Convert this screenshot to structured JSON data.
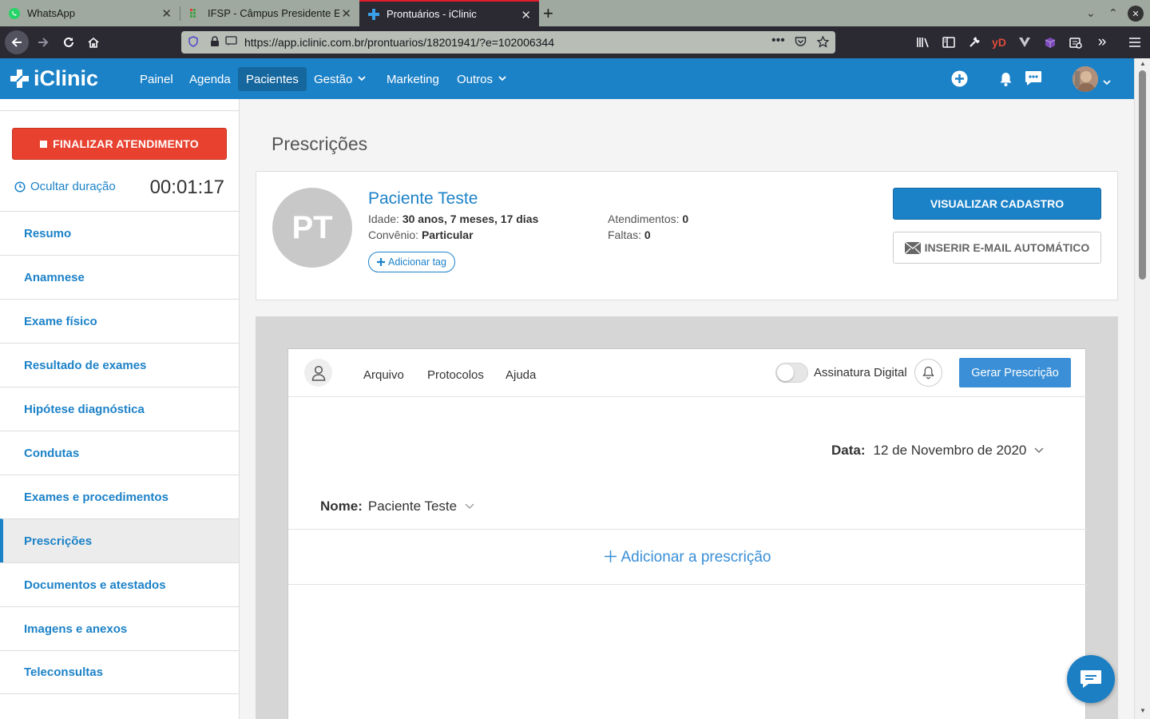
{
  "browser": {
    "tabs": [
      {
        "title": "WhatsApp",
        "icon": "whatsapp-icon"
      },
      {
        "title": "IFSP - Câmpus Presidente E",
        "icon": "ifsp-icon"
      },
      {
        "title": "Prontuários - iClinic",
        "icon": "iclinic-icon",
        "active": true
      }
    ],
    "url": "https://app.iclinic.com.br/prontuarios/18201941/?e=102006344"
  },
  "app": {
    "logo": "iClinic",
    "nav": [
      {
        "label": "Painel"
      },
      {
        "label": "Agenda"
      },
      {
        "label": "Pacientes",
        "active": true
      },
      {
        "label": "Gestão",
        "dropdown": true
      },
      {
        "label": "Marketing"
      },
      {
        "label": "Outros",
        "dropdown": true
      }
    ],
    "brand_color": "#1c82c8"
  },
  "sidebar": {
    "finish_button": "FINALIZAR ATENDIMENTO",
    "hide_duration": "Ocultar duração",
    "timer": "00:01:17",
    "items": [
      {
        "label": "Resumo"
      },
      {
        "label": "Anamnese"
      },
      {
        "label": "Exame físico"
      },
      {
        "label": "Resultado de exames"
      },
      {
        "label": "Hipótese diagnóstica"
      },
      {
        "label": "Condutas"
      },
      {
        "label": "Exames e procedimentos"
      },
      {
        "label": "Prescrições",
        "active": true
      },
      {
        "label": "Documentos e atestados"
      },
      {
        "label": "Imagens e anexos"
      },
      {
        "label": "Teleconsultas"
      }
    ]
  },
  "main": {
    "title": "Prescrições",
    "patient": {
      "initials": "PT",
      "name": "Paciente Teste",
      "age_label": "Idade:",
      "age": "30 anos, 7 meses, 17 dias",
      "insurance_label": "Convênio:",
      "insurance": "Particular",
      "appointments_label": "Atendimentos:",
      "appointments": "0",
      "absences_label": "Faltas:",
      "absences": "0",
      "add_tag": "Adicionar tag",
      "view_button": "VISUALIZAR CADASTRO",
      "email_button": "INSERIR E-MAIL AUTOMÁTICO"
    },
    "prescription": {
      "menu": [
        "Arquivo",
        "Protocolos",
        "Ajuda"
      ],
      "digital_signature": "Assinatura Digital",
      "generate_button": "Gerar Prescrição",
      "date_label": "Data:",
      "date_value": "12 de Novembro de 2020",
      "name_label": "Nome:",
      "name_value": "Paciente Teste",
      "add_label": "Adicionar a prescrição"
    }
  }
}
